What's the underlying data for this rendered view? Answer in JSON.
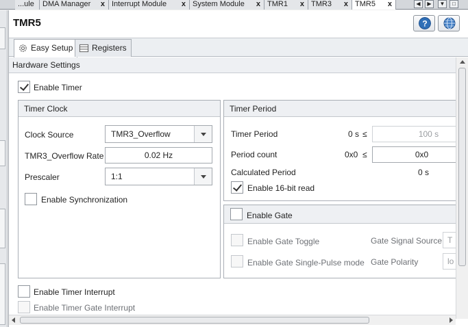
{
  "tabs": [
    {
      "label": "...ule",
      "close": "x",
      "active": false
    },
    {
      "label": "DMA Manager",
      "close": "x",
      "active": false
    },
    {
      "label": "Interrupt Module",
      "close": "x",
      "active": false
    },
    {
      "label": "System Module",
      "close": "x",
      "active": false
    },
    {
      "label": "TMR1",
      "close": "x",
      "active": false
    },
    {
      "label": "TMR3",
      "close": "x",
      "active": false
    },
    {
      "label": "TMR5",
      "close": "x",
      "active": true
    }
  ],
  "panel": {
    "title": "TMR5",
    "help_icon": "help-icon",
    "globe_icon": "globe-icon"
  },
  "subtabs": [
    {
      "label": "Easy Setup",
      "icon": "gear-icon",
      "active": true
    },
    {
      "label": "Registers",
      "icon": "table-icon",
      "active": false
    }
  ],
  "hardware_settings": {
    "title": "Hardware Settings",
    "enable_timer": {
      "label": "Enable Timer",
      "checked": true
    }
  },
  "timer_clock": {
    "title": "Timer Clock",
    "clock_source_label": "Clock Source",
    "clock_source_value": "TMR3_Overflow",
    "overflow_rate_label": "TMR3_Overflow Rate",
    "overflow_rate_value": "0.02 Hz",
    "prescaler_label": "Prescaler",
    "prescaler_value": "1:1",
    "enable_sync": {
      "label": "Enable Synchronization",
      "checked": false
    }
  },
  "timer_period": {
    "title": "Timer Period",
    "period_label": "Timer Period",
    "period_min": "0 s",
    "period_cmp": "≤",
    "period_value": "100 s",
    "count_label": "Period count",
    "count_min": "0x0",
    "count_cmp": "≤",
    "count_value": "0x0",
    "calc_label": "Calculated Period",
    "calc_value": "0 s",
    "enable_16bit": {
      "label": "Enable 16-bit read",
      "checked": true
    }
  },
  "gate": {
    "enable_gate": {
      "label": "Enable Gate",
      "checked": false
    },
    "gate_toggle": {
      "label": "Enable Gate Toggle",
      "checked": false
    },
    "gate_single_pulse": {
      "label": "Enable Gate Single-Pulse mode",
      "checked": false
    },
    "signal_source_label": "Gate Signal Source",
    "signal_source_value": "T",
    "polarity_label": "Gate Polarity",
    "polarity_value": "lo"
  },
  "interrupts": {
    "timer_interrupt": {
      "label": "Enable Timer Interrupt",
      "checked": false
    },
    "gate_interrupt": {
      "label": "Enable Timer Gate Interrupt",
      "checked": false
    }
  }
}
